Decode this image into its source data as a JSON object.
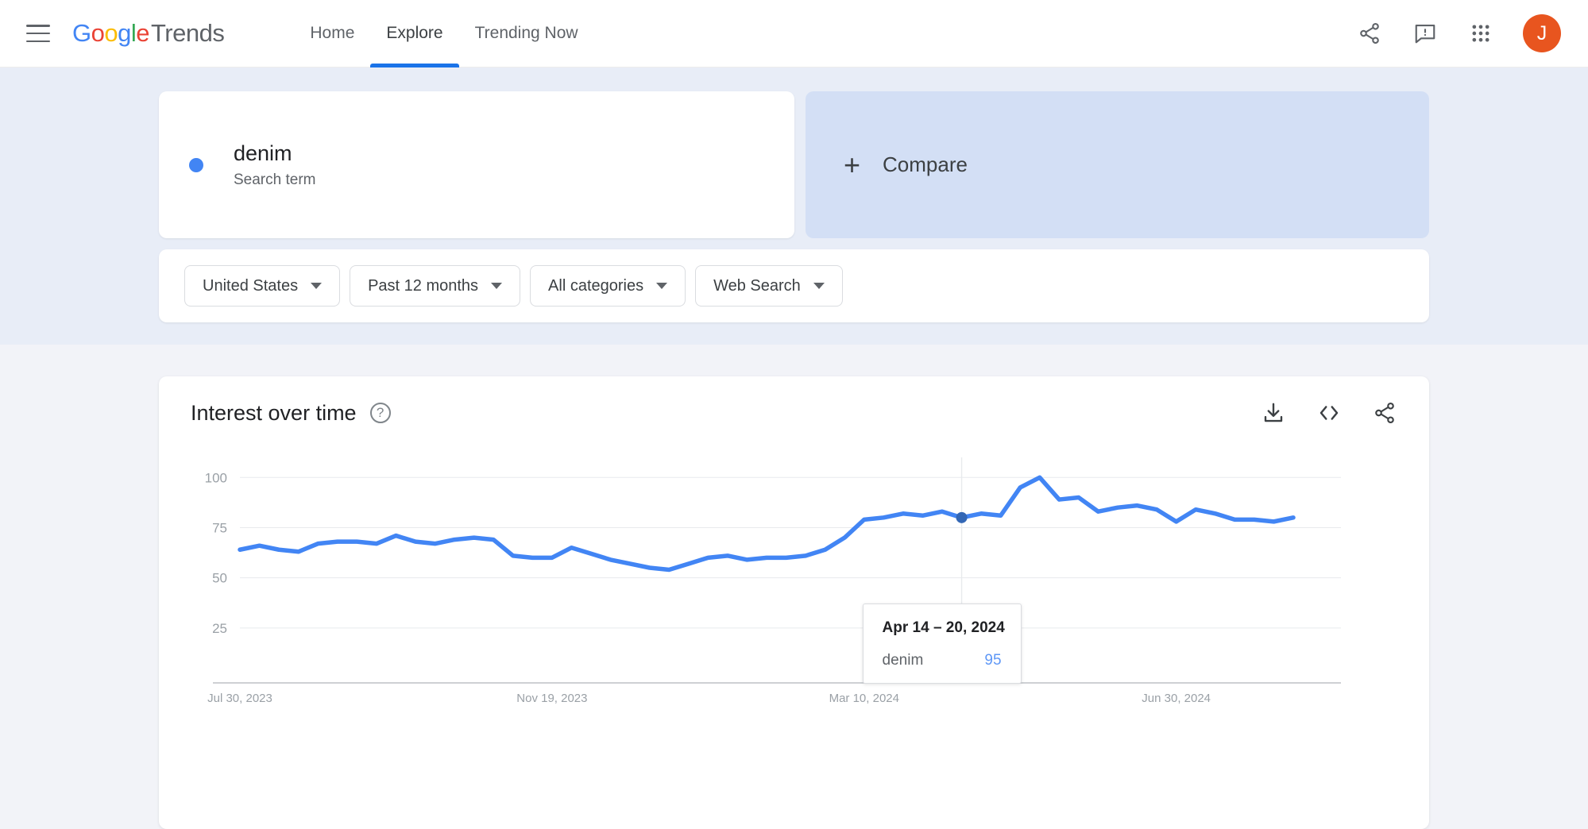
{
  "header": {
    "menu_icon": "hamburger-menu-icon",
    "brand": {
      "g1": "G",
      "o1": "o",
      "o2": "o",
      "g2": "g",
      "l": "l",
      "e": "e",
      "trends": "Trends"
    },
    "nav": [
      {
        "label": "Home",
        "active": false
      },
      {
        "label": "Explore",
        "active": true
      },
      {
        "label": "Trending Now",
        "active": false
      }
    ],
    "icons": [
      "share-icon",
      "feedback-icon",
      "apps-grid-icon"
    ],
    "avatar_initial": "J",
    "avatar_color": "#E8551F"
  },
  "search": {
    "term": "denim",
    "type_label": "Search term",
    "dot_color": "#4285F4",
    "compare_label": "Compare",
    "compare_plus": "+"
  },
  "filters": [
    {
      "label": "United States",
      "name": "location-filter"
    },
    {
      "label": "Past 12 months",
      "name": "time-range-filter"
    },
    {
      "label": "All categories",
      "name": "category-filter"
    },
    {
      "label": "Web Search",
      "name": "search-type-filter"
    }
  ],
  "chart_card": {
    "title": "Interest over time",
    "help": "?",
    "actions": [
      "download-icon",
      "embed-code-icon",
      "share-icon"
    ]
  },
  "tooltip": {
    "date": "Apr 14 – 20, 2024",
    "series_name": "denim",
    "value": "95"
  },
  "chart_data": {
    "type": "line",
    "title": "Interest over time",
    "xlabel": "",
    "ylabel": "",
    "ylim": [
      0,
      110
    ],
    "yticks": [
      25,
      50,
      75,
      100
    ],
    "ytick_labels": [
      "25",
      "50",
      "75",
      "100"
    ],
    "grid": true,
    "legend_position": "none",
    "line_color": "#4285F4",
    "xtick_labels": [
      "Jul 30, 2023",
      "Nov 19, 2023",
      "Mar 10, 2024",
      "Jun 30, 2024"
    ],
    "xtick_indices": [
      0,
      16,
      32,
      48
    ],
    "highlight": {
      "index": 37,
      "label": "Apr 14 – 20, 2024",
      "value": 95
    },
    "x": [
      "Jul 30, 2023",
      "Aug 6, 2023",
      "Aug 13, 2023",
      "Aug 20, 2023",
      "Aug 27, 2023",
      "Sep 3, 2023",
      "Sep 10, 2023",
      "Sep 17, 2023",
      "Sep 24, 2023",
      "Oct 1, 2023",
      "Oct 8, 2023",
      "Oct 15, 2023",
      "Oct 22, 2023",
      "Oct 29, 2023",
      "Nov 5, 2023",
      "Nov 12, 2023",
      "Nov 19, 2023",
      "Nov 26, 2023",
      "Dec 3, 2023",
      "Dec 10, 2023",
      "Dec 17, 2023",
      "Dec 24, 2023",
      "Dec 31, 2023",
      "Jan 7, 2024",
      "Jan 14, 2024",
      "Jan 21, 2024",
      "Jan 28, 2024",
      "Feb 4, 2024",
      "Feb 11, 2024",
      "Feb 18, 2024",
      "Feb 25, 2024",
      "Mar 3, 2024",
      "Mar 10, 2024",
      "Mar 17, 2024",
      "Mar 24, 2024",
      "Mar 31, 2024",
      "Apr 7, 2024",
      "Apr 14, 2024",
      "Apr 21, 2024",
      "Apr 28, 2024",
      "May 5, 2024",
      "May 12, 2024",
      "May 19, 2024",
      "May 26, 2024",
      "Jun 2, 2024",
      "Jun 9, 2024",
      "Jun 16, 2024",
      "Jun 23, 2024",
      "Jun 30, 2024",
      "Jul 7, 2024",
      "Jul 14, 2024"
    ],
    "series": [
      {
        "name": "denim",
        "color": "#4285F4",
        "values": [
          64,
          66,
          64,
          63,
          67,
          68,
          68,
          67,
          71,
          68,
          67,
          69,
          70,
          69,
          61,
          60,
          60,
          65,
          62,
          59,
          57,
          55,
          54,
          57,
          60,
          61,
          59,
          60,
          60,
          61,
          64,
          70,
          79,
          80,
          82,
          81,
          83,
          80,
          82,
          81,
          95,
          100,
          89,
          90,
          83,
          85,
          86,
          84,
          78,
          84,
          82,
          79,
          79,
          78,
          80
        ]
      }
    ]
  }
}
